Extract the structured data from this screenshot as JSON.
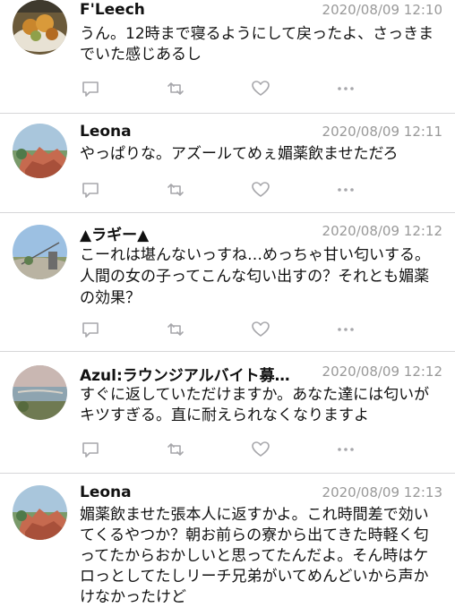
{
  "tweets": [
    {
      "name": "F'Leech",
      "timestamp": "2020/08/09 12:10",
      "text": "うん。12時まで寝るようにして戻ったよ、さっきまでいた感じあるし",
      "avatar": "food-photo"
    },
    {
      "name": "Leona",
      "timestamp": "2020/08/09 12:11",
      "text": "やっぱりな。アズールてめぇ媚薬飲ませただろ",
      "avatar": "rock-landscape"
    },
    {
      "name": "▲ラギー▲",
      "timestamp": "2020/08/09 12:12",
      "text": "こーれは堪んないっすね…めっちゃ甘い匂いする。人間の女の子ってこんな匂い出すの？それとも媚薬の効果？",
      "avatar": "field-sky"
    },
    {
      "name": "Azul:ラウンジアルバイト募…",
      "timestamp": "2020/08/09 12:12",
      "text": "すぐに返していただけますか。あなた達には匂いがキツすぎる。直に耐えられなくなりますよ",
      "avatar": "lake-scene"
    },
    {
      "name": "Leona",
      "timestamp": "2020/08/09 12:13",
      "text": "媚薬飲ませた張本人に返すかよ。これ時間差で効いてくるやつか？朝お前らの寮から出てきた時軽く匂ってたからおかしいと思ってたんだよ。そん時はケロっとしてたしリーチ兄弟がいてめんどいから声かけなかったけど",
      "avatar": "rock-landscape"
    }
  ],
  "icons": [
    "reply-icon",
    "retweet-icon",
    "like-icon",
    "more-icon"
  ],
  "colors": {
    "icon": "#a7a7ab",
    "timestamp": "#999999",
    "divider": "#d6d6d8"
  }
}
